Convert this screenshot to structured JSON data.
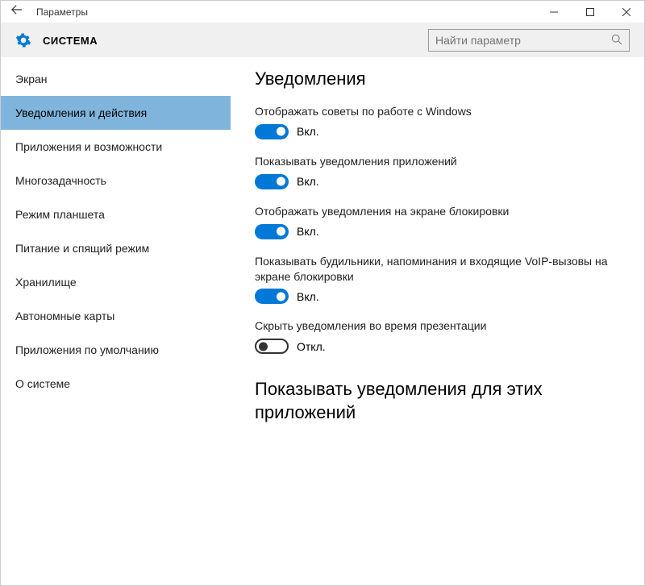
{
  "window": {
    "title": "Параметры"
  },
  "header": {
    "heading": "СИСТЕМА",
    "search_placeholder": "Найти параметр"
  },
  "sidebar": {
    "items": [
      {
        "label": "Экран",
        "selected": false
      },
      {
        "label": "Уведомления и действия",
        "selected": true
      },
      {
        "label": "Приложения и возможности",
        "selected": false
      },
      {
        "label": "Многозадачность",
        "selected": false
      },
      {
        "label": "Режим планшета",
        "selected": false
      },
      {
        "label": "Питание и спящий режим",
        "selected": false
      },
      {
        "label": "Хранилище",
        "selected": false
      },
      {
        "label": "Автономные карты",
        "selected": false
      },
      {
        "label": "Приложения по умолчанию",
        "selected": false
      },
      {
        "label": "О системе",
        "selected": false
      }
    ]
  },
  "content": {
    "title": "Уведомления",
    "toggle_on_text": "Вкл.",
    "toggle_off_text": "Откл.",
    "settings": [
      {
        "label": "Отображать советы по работе с Windows",
        "on": true
      },
      {
        "label": "Показывать уведомления приложений",
        "on": true
      },
      {
        "label": "Отображать уведомления на экране блокировки",
        "on": true
      },
      {
        "label": "Показывать будильники, напоминания и входящие VoIP-вызовы на экране блокировки",
        "on": true
      },
      {
        "label": "Скрыть уведомления во время презентации",
        "on": false
      }
    ],
    "subtitle": "Показывать уведомления для этих приложений"
  }
}
